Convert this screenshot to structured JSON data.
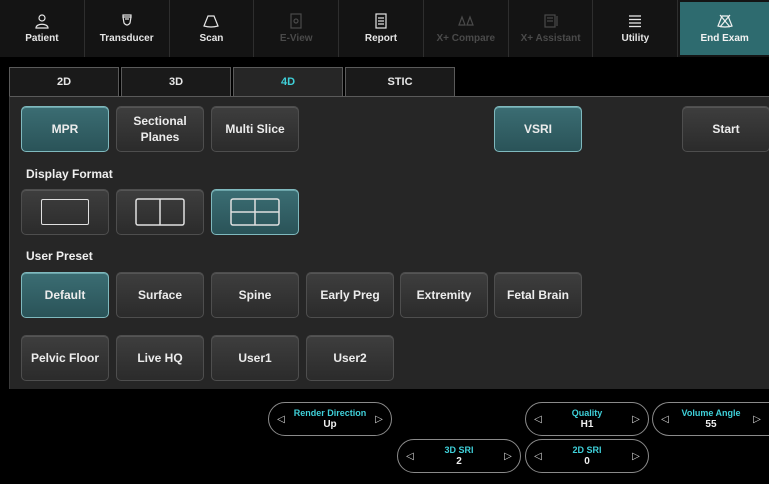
{
  "toolbar": {
    "items": [
      {
        "label": "Patient",
        "icon": "person-icon",
        "disabled": false
      },
      {
        "label": "Transducer",
        "icon": "transducer-icon",
        "disabled": false
      },
      {
        "label": "Scan",
        "icon": "scan-icon",
        "disabled": false
      },
      {
        "label": "E-View",
        "icon": "eview-icon",
        "disabled": true
      },
      {
        "label": "Report",
        "icon": "report-icon",
        "disabled": false
      },
      {
        "label": "X+ Compare",
        "icon": "compare-icon",
        "disabled": true
      },
      {
        "label": "X+ Assistant",
        "icon": "assistant-icon",
        "disabled": true
      },
      {
        "label": "Utility",
        "icon": "menu-icon",
        "disabled": false
      },
      {
        "label": "End Exam",
        "icon": "end-exam-icon",
        "disabled": false,
        "active": true
      }
    ]
  },
  "tabs": [
    {
      "label": "2D"
    },
    {
      "label": "3D"
    },
    {
      "label": "4D",
      "active": true
    },
    {
      "label": "STIC"
    }
  ],
  "modes": {
    "mpr": "MPR",
    "sectional_line1": "Sectional",
    "sectional_line2": "Planes",
    "multi_slice": "Multi Slice",
    "vsri": "VSRI",
    "start": "Start"
  },
  "display_format": {
    "label": "Display Format",
    "options": [
      "single-layout-icon",
      "dual-layout-icon",
      "quad-layout-icon"
    ],
    "selected": "quad-layout-icon"
  },
  "user_preset": {
    "label": "User Preset",
    "items": [
      "Default",
      "Surface",
      "Spine",
      "Early Preg",
      "Extremity",
      "Fetal Brain",
      "Pelvic Floor",
      "Live HQ",
      "User1",
      "User2"
    ],
    "selected": "Default"
  },
  "knobs": {
    "render_direction": {
      "name": "Render Direction",
      "value": "Up"
    },
    "quality": {
      "name": "Quality",
      "value": "H1"
    },
    "volume_angle": {
      "name": "Volume Angle",
      "value": "55"
    },
    "sri_3d": {
      "name": "3D SRI",
      "value": "2"
    },
    "sri_2d": {
      "name": "2D SRI",
      "value": "0"
    }
  },
  "colors": {
    "accent": "#3fd0d9",
    "selected_button": "#2f5f64",
    "end_exam_bg": "#2e6b6f",
    "panel_bg": "#262626"
  }
}
